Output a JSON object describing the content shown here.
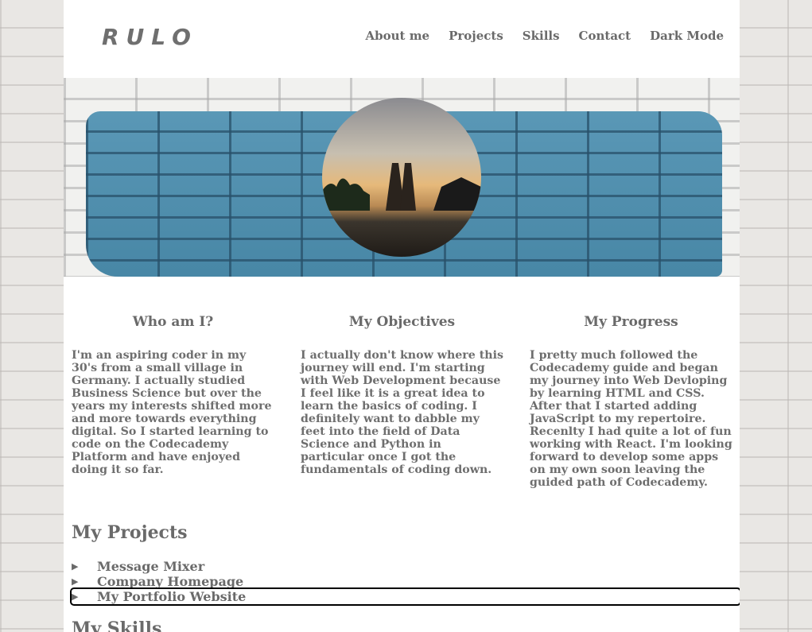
{
  "header": {
    "logo": "RULO",
    "nav": [
      "About me",
      "Projects",
      "Skills",
      "Contact",
      "Dark Mode"
    ]
  },
  "columns": [
    {
      "title": "Who am I?",
      "text": "I'm an aspiring coder in my 30's from a small village in Germany. I actually studied Business Science but over the years my interests shifted more and more towards everything digital. So I started learning to code on the Codecademy Platform and have enjoyed doing it so far."
    },
    {
      "title": "My Objectives",
      "text": "I actually don't know where this journey will end. I'm starting with Web Development because I feel like it is a great idea to learn the basics of coding. I definitely want to dabble my feet into the field of Data Science and Python in particular once I got the fundamentals of coding down."
    },
    {
      "title": "My Progress",
      "text": "I pretty much followed the Codecademy guide and began my journey into Web Devloping by learning HTML and CSS. After that I started adding JavaScript to my repertoire. Recenlty I had quite a lot of fun working with React. I'm looking forward to develop some apps on my own soon leaving the guided path of Codecademy."
    }
  ],
  "projects": {
    "title": "My Projects",
    "items": [
      "Message Mixer",
      "Company Homepage",
      "My Portfolio Website"
    ],
    "focused_index": 2
  },
  "skills": {
    "title": "My Skills"
  },
  "colors": {
    "text": "#6a6a6a",
    "paint_blue": "#4c8fb0",
    "page_bg": "#ffffff"
  }
}
